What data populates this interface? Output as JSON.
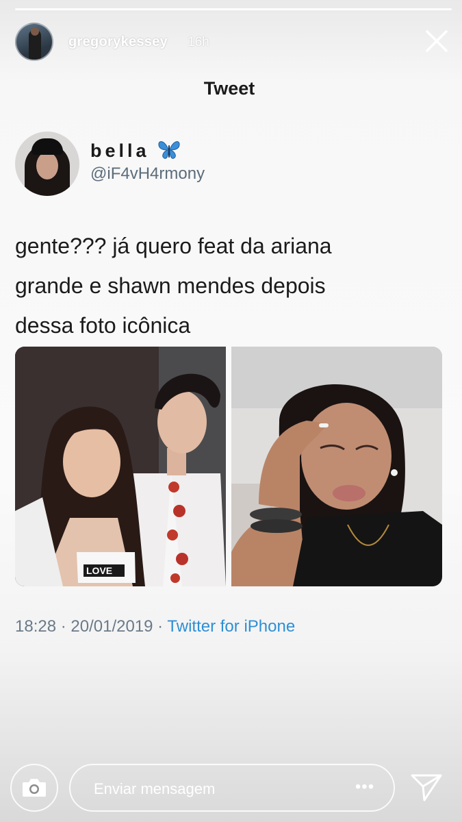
{
  "story": {
    "username": "gregorykessey",
    "time_ago": "16h",
    "progress": 1.0
  },
  "header": {
    "title": "Tweet"
  },
  "tweet": {
    "display_name": "bella",
    "handle": "@iF4vH4rmony",
    "text_lines": [
      "gente??? já quero feat da ariana",
      "grande e shawn mendes depois",
      "dessa foto icônica"
    ],
    "time": "18:28",
    "date": "20/01/2019",
    "separator": " · ",
    "source": "Twitter for iPhone"
  },
  "footer": {
    "message_placeholder": "Enviar mensagem",
    "more_label": "•••"
  },
  "colors": {
    "link": "#2d8fd5",
    "butterfly": "#3a8fd8",
    "meta": "#6a7a88"
  },
  "icons": {
    "camera": "camera-icon",
    "send": "send-icon",
    "close": "close-icon",
    "butterfly": "butterfly-emoji-icon"
  }
}
